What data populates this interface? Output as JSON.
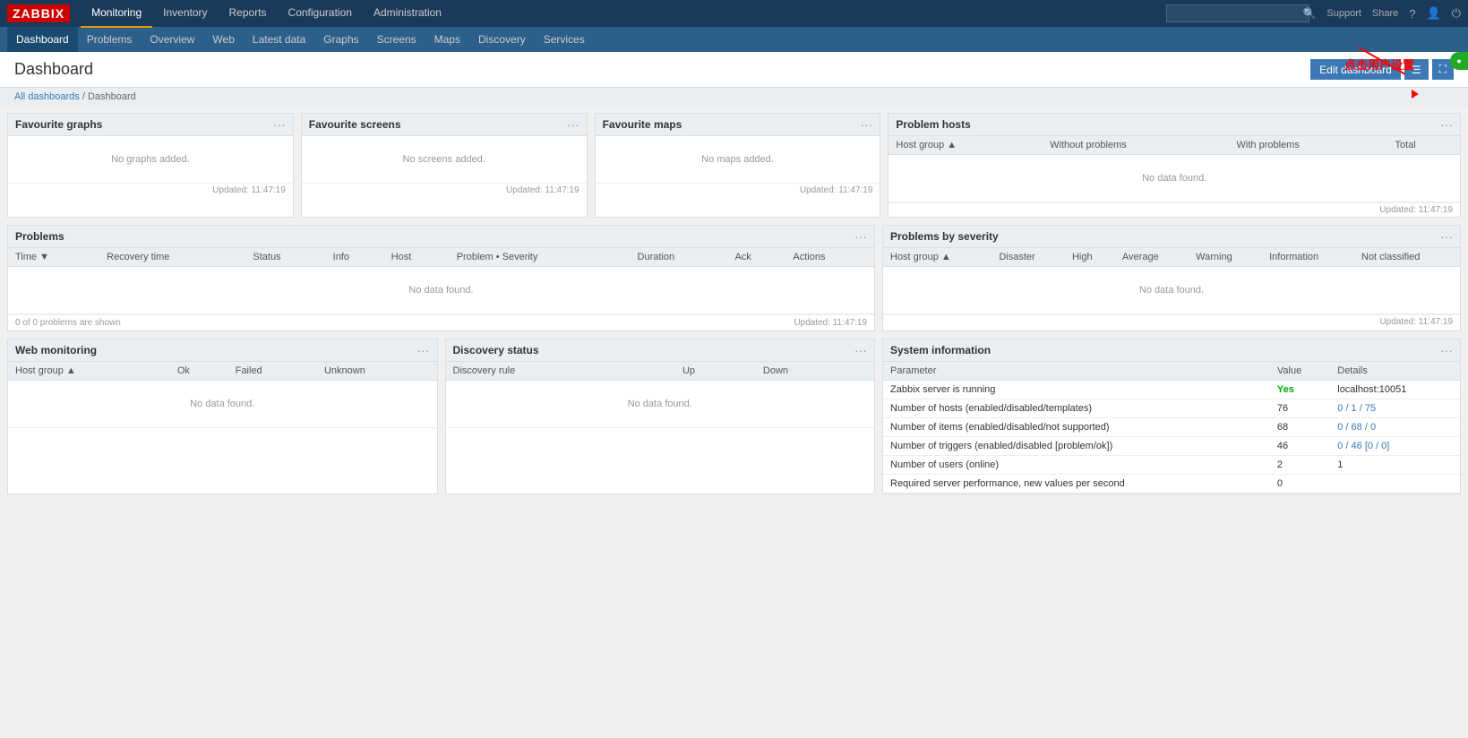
{
  "logo": "ZABBIX",
  "nav": {
    "items": [
      {
        "label": "Monitoring",
        "active": true
      },
      {
        "label": "Inventory",
        "active": false
      },
      {
        "label": "Reports",
        "active": false
      },
      {
        "label": "Configuration",
        "active": false
      },
      {
        "label": "Administration",
        "active": false
      }
    ],
    "right": {
      "support": "Support",
      "share": "Share",
      "help": "?",
      "profile": "👤",
      "power": "⏻"
    },
    "search_placeholder": ""
  },
  "subnav": {
    "items": [
      {
        "label": "Dashboard",
        "active": true
      },
      {
        "label": "Problems",
        "active": false
      },
      {
        "label": "Overview",
        "active": false
      },
      {
        "label": "Web",
        "active": false
      },
      {
        "label": "Latest data",
        "active": false
      },
      {
        "label": "Graphs",
        "active": false
      },
      {
        "label": "Screens",
        "active": false
      },
      {
        "label": "Maps",
        "active": false
      },
      {
        "label": "Discovery",
        "active": false
      },
      {
        "label": "Services",
        "active": false
      }
    ]
  },
  "page": {
    "title": "Dashboard",
    "edit_button": "Edit dashboard"
  },
  "breadcrumb": {
    "all_dashboards": "All dashboards",
    "separator": "/",
    "current": "Dashboard"
  },
  "widgets": {
    "favourite_graphs": {
      "title": "Favourite graphs",
      "no_data": "No graphs added.",
      "updated": "Updated: 11:47:19"
    },
    "favourite_screens": {
      "title": "Favourite screens",
      "no_data": "No screens added.",
      "updated": "Updated: 11:47:19"
    },
    "favourite_maps": {
      "title": "Favourite maps",
      "no_data": "No maps added.",
      "updated": "Updated: 11:47:19"
    },
    "problem_hosts": {
      "title": "Problem hosts",
      "columns": [
        "Host group ▲",
        "Without problems",
        "With problems",
        "Total"
      ],
      "no_data": "No data found.",
      "updated": "Updated: 11:47:19"
    },
    "problems": {
      "title": "Problems",
      "columns": [
        "Time ▼",
        "Recovery time",
        "Status",
        "Info",
        "Host",
        "Problem • Severity",
        "Duration",
        "Ack",
        "Actions"
      ],
      "no_data": "No data found.",
      "footer_left": "0 of 0 problems are shown",
      "footer_right": "Updated: 11:47:19"
    },
    "problems_by_severity": {
      "title": "Problems by severity",
      "columns": [
        "Host group ▲",
        "Disaster",
        "High",
        "Average",
        "Warning",
        "Information",
        "Not classified"
      ],
      "no_data": "No data found.",
      "updated": "Updated: 11:47:19"
    },
    "web_monitoring": {
      "title": "Web monitoring",
      "columns": [
        "Host group ▲",
        "Ok",
        "Failed",
        "Unknown"
      ],
      "no_data": "No data found."
    },
    "discovery_status": {
      "title": "Discovery status",
      "columns": [
        "Discovery rule",
        "Up",
        "Down"
      ],
      "no_data": "No data found."
    },
    "system_information": {
      "title": "System information",
      "columns": [
        "Parameter",
        "Value",
        "Details"
      ],
      "rows": [
        {
          "param": "Zabbix server is running",
          "value": "Yes",
          "details": "localhost:10051",
          "value_class": "val-yes"
        },
        {
          "param": "Number of hosts (enabled/disabled/templates)",
          "value": "76",
          "details": "0 / 1 / 75",
          "value_class": "val-num"
        },
        {
          "param": "Number of items (enabled/disabled/not supported)",
          "value": "68",
          "details": "0 / 68 / 0",
          "value_class": "val-num"
        },
        {
          "param": "Number of triggers (enabled/disabled [problem/ok])",
          "value": "46",
          "details": "0 / 46 [0 / 0]",
          "value_class": "val-num"
        },
        {
          "param": "Number of users (online)",
          "value": "2",
          "details": "1",
          "value_class": "val-num"
        },
        {
          "param": "Required server performance, new values per second",
          "value": "0",
          "details": "",
          "value_class": "val-num"
        }
      ]
    }
  },
  "annotation": {
    "text": "点击用户设置",
    "color": "red"
  }
}
